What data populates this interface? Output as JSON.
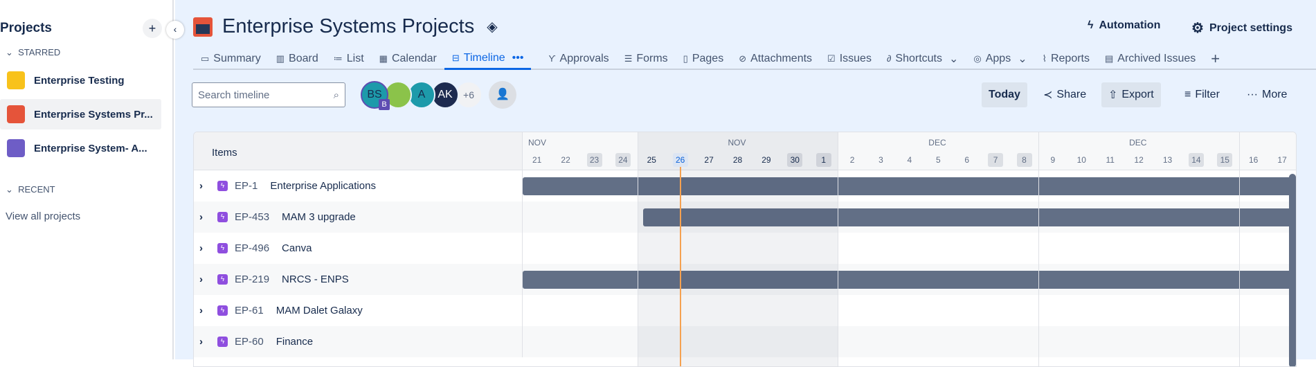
{
  "sidebar": {
    "title": "Projects",
    "add": "+",
    "collapse": "‹",
    "starred_label": "STARRED",
    "recent_label": "RECENT",
    "view_all": "View all projects",
    "items": [
      {
        "label": "Enterprise Testing",
        "color": "#f8c21b"
      },
      {
        "label": "Enterprise Systems Pr...",
        "color": "#e5543a"
      },
      {
        "label": "Enterprise System- A...",
        "color": "#6e5dc6"
      }
    ]
  },
  "header": {
    "title": "Enterprise Systems Projects",
    "automation": "Automation",
    "settings": "Project settings"
  },
  "tabs": [
    {
      "icon": "▭",
      "label": "Summary"
    },
    {
      "icon": "▥",
      "label": "Board"
    },
    {
      "icon": "≔",
      "label": "List"
    },
    {
      "icon": "▦",
      "label": "Calendar"
    },
    {
      "icon": "⊟",
      "label": "Timeline",
      "more": "•••"
    },
    {
      "icon": "ϒ",
      "label": "Approvals"
    },
    {
      "icon": "☰",
      "label": "Forms"
    },
    {
      "icon": "▯",
      "label": "Pages"
    },
    {
      "icon": "⊘",
      "label": "Attachments"
    },
    {
      "icon": "☑",
      "label": "Issues"
    },
    {
      "icon": "∂",
      "label": "Shortcuts",
      "caret": "⌄"
    },
    {
      "icon": "◎",
      "label": "Apps",
      "caret": "⌄"
    },
    {
      "icon": "⌇",
      "label": "Reports"
    },
    {
      "icon": "▤",
      "label": "Archived Issues"
    }
  ],
  "add_tab": "+",
  "toolbar": {
    "search_placeholder": "Search timeline",
    "avatars": [
      "BS",
      "",
      "A",
      "AK"
    ],
    "avatar_badge": "B",
    "more_count": "+6",
    "today": "Today",
    "share": "Share",
    "export": "Export",
    "filter": "Filter",
    "more": "More"
  },
  "timeline": {
    "items_header": "Items",
    "months": [
      {
        "label": "NOV",
        "start": 0
      },
      {
        "label": "NOV",
        "start": 4,
        "center": true
      },
      {
        "label": "DEC",
        "start": 11,
        "center": true
      },
      {
        "label": "DEC",
        "start": 18,
        "center": true
      }
    ],
    "days": [
      "21",
      "22",
      "23",
      "24",
      "25",
      "26",
      "27",
      "28",
      "29",
      "30",
      "1",
      "2",
      "3",
      "4",
      "5",
      "6",
      "7",
      "8",
      "9",
      "10",
      "11",
      "12",
      "13",
      "14",
      "15",
      "16",
      "17"
    ],
    "weekend_idx": [
      2,
      3,
      9,
      10,
      16,
      17,
      23,
      24
    ],
    "today_idx": 5,
    "rows": [
      {
        "key": "EP-1",
        "title": "Enterprise Applications",
        "bar_start_day": -1
      },
      {
        "key": "EP-453",
        "title": "MAM 3 upgrade",
        "bar_start_day": 4.2
      },
      {
        "key": "EP-496",
        "title": "Canva",
        "bar_start_day": null
      },
      {
        "key": "EP-219",
        "title": "NRCS - ENPS",
        "bar_start_day": -1
      },
      {
        "key": "EP-61",
        "title": "MAM Dalet Galaxy",
        "bar_start_day": null
      },
      {
        "key": "EP-60",
        "title": "Finance",
        "bar_start_day": null
      }
    ]
  }
}
